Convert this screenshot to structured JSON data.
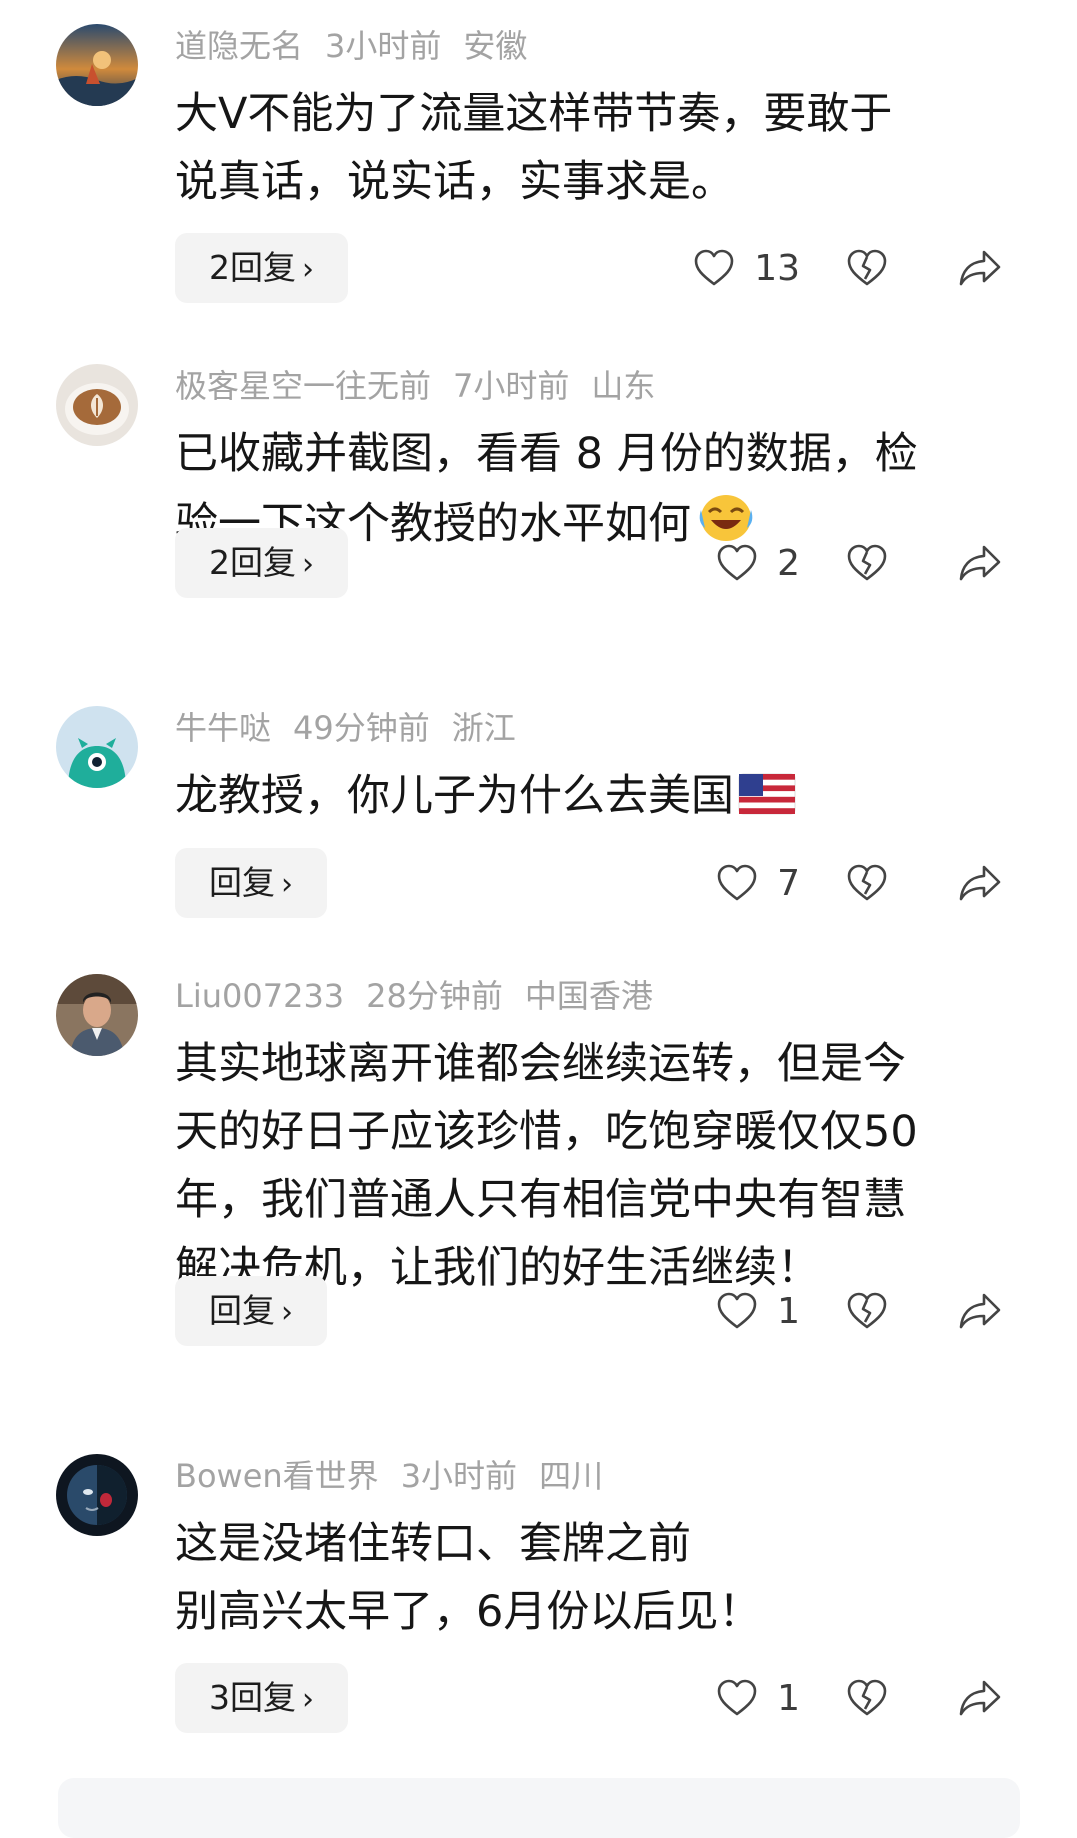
{
  "comments": [
    {
      "username": "道隐无名",
      "time": "3小时前",
      "location": "安徽",
      "text": "大V不能为了流量这样带节奏，要敢于\n说真话，说实话，实事求是。",
      "reply_label": "2回复",
      "likes": "13",
      "avatar": "sunset-scene"
    },
    {
      "username": "极客星空一往无前",
      "time": "7小时前",
      "location": "山东",
      "text": "已收藏并截图，看看 8 月份的数据，检\n验一下这个教授的水平如何",
      "emoji": "laughing-crying-emoji",
      "reply_label": "2回复",
      "likes": "2",
      "avatar": "latte-art"
    },
    {
      "username": "牛牛哒",
      "time": "49分钟前",
      "location": "浙江",
      "text": "龙教授，你儿子为什么去美国",
      "emoji": "us-flag-emoji",
      "reply_label": "回复",
      "likes": "7",
      "avatar": "teal-monster"
    },
    {
      "username": "Liu007233",
      "time": "28分钟前",
      "location": "中国香港",
      "text": "其实地球离开谁都会继续运转，但是今\n天的好日子应该珍惜，吃饱穿暖仅仅50\n年，我们普通人只有相信党中央有智慧\n解决危机，让我们的好生活继续！",
      "reply_label": "回复",
      "likes": "1",
      "avatar": "man-portrait"
    },
    {
      "username": "Bowen看世界",
      "time": "3小时前",
      "location": "四川",
      "text": "这是没堵住转口、套牌之前\n别高兴太早了，6月份以后见！",
      "reply_label": "3回复",
      "likes": "1",
      "avatar": "dark-mask-art"
    }
  ],
  "icons": {
    "like": "heart-outline-icon",
    "dislike": "broken-heart-icon",
    "share": "share-arrow-icon",
    "chevron": "chevron-right-icon"
  },
  "colors": {
    "meta_text": "#a3a3a3",
    "body_text": "#161616",
    "reply_bg": "#f3f3f3",
    "icon_stroke": "#444444"
  }
}
